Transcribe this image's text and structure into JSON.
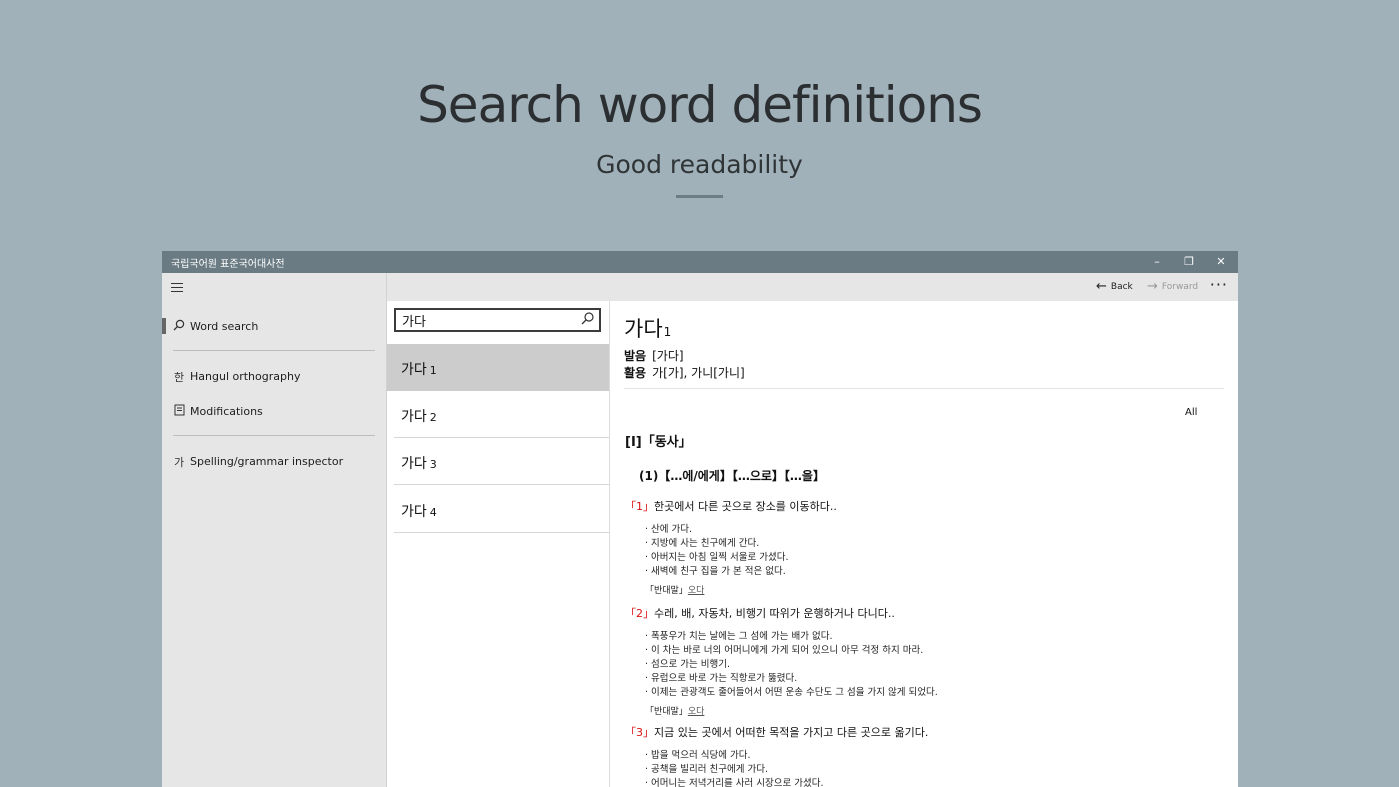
{
  "hero": {
    "title": "Search word definitions",
    "subtitle": "Good readability"
  },
  "window": {
    "title": "국립국어원 표준국어대사전",
    "minimize": "–",
    "maximize": "❐",
    "close": "✕"
  },
  "sidebar": {
    "items": [
      {
        "label": "Word search",
        "icon": "search-icon"
      },
      {
        "label": "Hangul orthography",
        "icon": "한"
      },
      {
        "label": "Modifications",
        "icon": "book-icon"
      },
      {
        "label": "Spelling/grammar inspector",
        "icon": "가"
      }
    ]
  },
  "toolbar": {
    "back": "Back",
    "forward": "Forward",
    "more": "···"
  },
  "search": {
    "value": "가다"
  },
  "results": [
    {
      "word": "가다",
      "num": "1"
    },
    {
      "word": "가다",
      "num": "2"
    },
    {
      "word": "가다",
      "num": "3"
    },
    {
      "word": "가다",
      "num": "4"
    }
  ],
  "entry": {
    "headword": "가다",
    "headword_num": "1",
    "pron_label": "발음",
    "pron": "[가다]",
    "conj_label": "활용",
    "conj": "가[가], 가니[가니]",
    "filter": "All",
    "pos": "[Ⅰ]「동사」",
    "pattern": "(1)【…에/에게】【…으로】【…을】",
    "senses": [
      {
        "num": "「1」",
        "def": "한곳에서 다른 곳으로 장소를 이동하다..",
        "examples": [
          "· 산에 가다.",
          "· 지방에 사는 친구에게 간다.",
          "· 아버지는 아침 일찍 서울로 가셨다.",
          "· 새벽에 친구 집을 가 본 적은 없다."
        ],
        "antonym_label": "「반대말」",
        "antonym": "오다"
      },
      {
        "num": "「2」",
        "def": "수레, 배, 자동차, 비행기 따위가 운행하거나 다니다..",
        "examples": [
          "· 폭풍우가 치는 날에는 그 섬에 가는 배가 없다.",
          "· 이 차는 바로 너의 어머니에게 가게 되어 있으니 아무 걱정 하지 마라.",
          "· 섬으로 가는 비행기.",
          "· 유럽으로 바로 가는 직항로가 뚫렸다.",
          "· 이제는 관광객도 줄어들어서 어떤 운송 수단도 그 섬을 가지 않게 되었다."
        ],
        "antonym_label": "「반대말」",
        "antonym": "오다"
      },
      {
        "num": "「3」",
        "def": "지금 있는 곳에서 어떠한 목적을 가지고 다른 곳으로 옮기다.",
        "examples": [
          "· 밥을 먹으러 식당에 가다.",
          "· 공책을 빌리러 친구에게 가다.",
          "· 어머니는 저녁거리를 사러 시장으로 가셨다."
        ]
      }
    ]
  }
}
